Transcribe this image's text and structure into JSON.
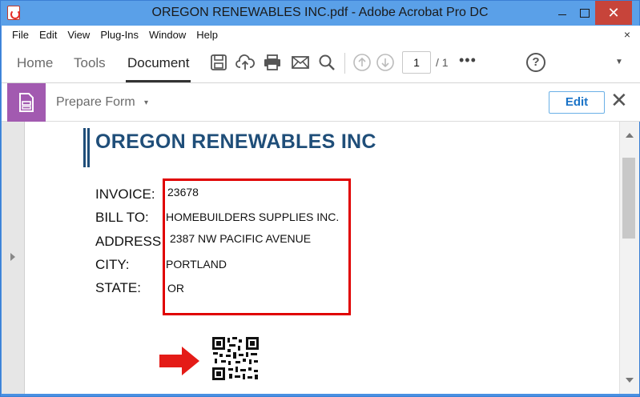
{
  "window": {
    "title": "OREGON RENEWABLES INC.pdf - Adobe Acrobat Pro DC",
    "close_glyph": "✕"
  },
  "menu": {
    "items": [
      "File",
      "Edit",
      "View",
      "Plug-Ins",
      "Window",
      "Help"
    ],
    "close_glyph": "×"
  },
  "toolbar": {
    "tabs": [
      "Home",
      "Tools",
      "Document"
    ],
    "active_tab": "Document",
    "icons": [
      "save-icon",
      "upload-cloud-icon",
      "print-icon",
      "email-icon",
      "search-icon",
      "page-up-icon",
      "page-down-icon"
    ],
    "page_number": "1",
    "page_total": "/ 1",
    "more": "•••",
    "help": "?",
    "dropdown": "▼"
  },
  "form_bar": {
    "label": "Prepare Form",
    "caret": "▾",
    "edit_label": "Edit",
    "close_glyph": "✕"
  },
  "document": {
    "company": "OREGON RENEWABLES INC",
    "fields": [
      {
        "label": "INVOICE:",
        "value": "23678"
      },
      {
        "label": "BILL TO:",
        "value": "HOMEBUILDERS SUPPLIES INC."
      },
      {
        "label": "ADDRESS",
        "value": "2387 NW PACIFIC AVENUE"
      },
      {
        "label": "CITY:",
        "value": "PORTLAND"
      },
      {
        "label": "STATE:",
        "value": "OR"
      }
    ],
    "highlight_color": "#e00000",
    "brand_color": "#1f4e79"
  }
}
